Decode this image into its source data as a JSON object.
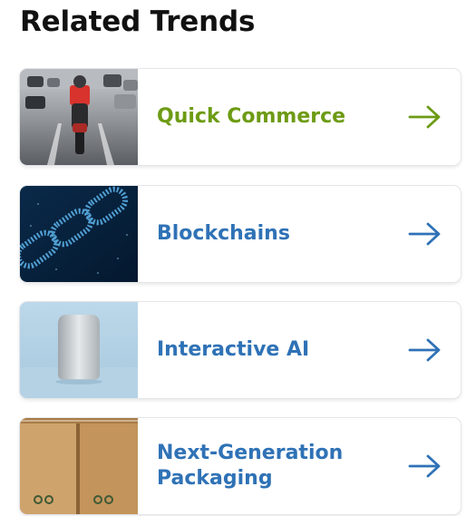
{
  "section": {
    "title": "Related Trends"
  },
  "trends": [
    {
      "label": "Quick Commerce",
      "color": "#6d9b14",
      "image": "motorbike-delivery-image"
    },
    {
      "label": "Blockchains",
      "color": "#2f72b6",
      "image": "digital-chain-image"
    },
    {
      "label": "Interactive AI",
      "color": "#2f72b6",
      "image": "smart-speaker-image"
    },
    {
      "label": "Next-Generation Packaging",
      "color": "#2f72b6",
      "image": "cardboard-boxes-image"
    }
  ],
  "icons": {
    "arrow": "arrow-right-icon"
  }
}
